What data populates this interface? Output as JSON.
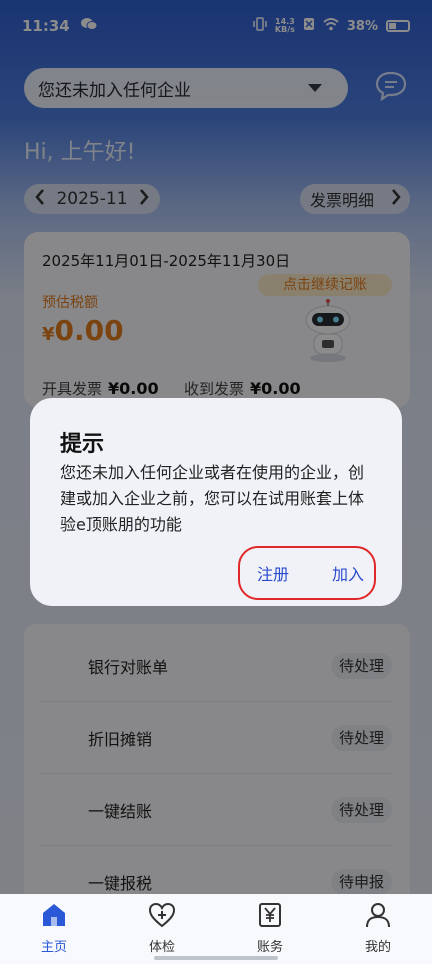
{
  "status": {
    "time": "11:34",
    "net_top": "14.3",
    "net_bottom": "KB/s",
    "battery": "38%"
  },
  "header": {
    "company_select": "您还未加入任何企业",
    "greeting": "Hi, 上午好!"
  },
  "period": {
    "month": "2025-11",
    "invoice_detail": "发票明细"
  },
  "summary": {
    "range": "2025年11月01日-2025年11月30日",
    "tax_label": "预估税额",
    "tax_currency": "¥",
    "tax_value": "0.00",
    "continue_label": "点击继续记账",
    "issued_label": "开具发票",
    "issued_value": "¥0.00",
    "received_label": "收到发票",
    "received_value": "¥0.00"
  },
  "tasks": [
    {
      "name": "银行对账单",
      "status": "待处理"
    },
    {
      "name": "折旧摊销",
      "status": "待处理"
    },
    {
      "name": "一键结账",
      "status": "待处理"
    },
    {
      "name": "一键报税",
      "status": "待申报"
    }
  ],
  "dialog": {
    "title": "提示",
    "body": "您还未加入任何企业或者在使用的企业，创建或加入企业之前，您可以在试用账套上体验e顶账朋的功能",
    "register": "注册",
    "join": "加入"
  },
  "tabbar": [
    {
      "label": "主页",
      "icon": "home-icon"
    },
    {
      "label": "体检",
      "icon": "heart-plus-icon"
    },
    {
      "label": "账务",
      "icon": "ledger-yen-icon"
    },
    {
      "label": "我的",
      "icon": "person-icon"
    }
  ],
  "colors": {
    "accent": "#2a58d6",
    "orange": "#e07b1e",
    "highlight": "#e02828"
  }
}
